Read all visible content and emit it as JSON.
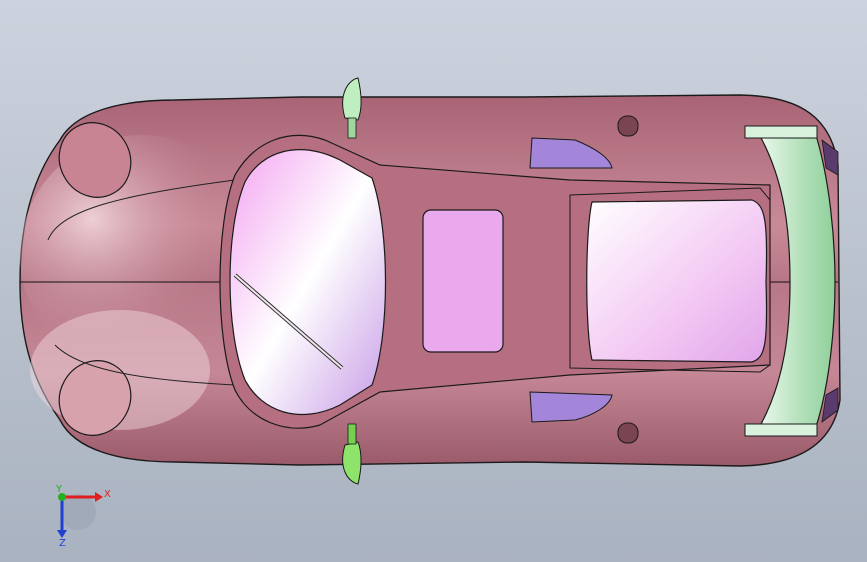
{
  "viewport": {
    "background_top": "#cdd3de",
    "background_bottom": "#a9b2c0",
    "model": "car-top-view"
  },
  "colors": {
    "body_pink": "#b87786",
    "body_light": "#e9c6cc",
    "glass": "#f0b8f0",
    "green": "#9fe79a",
    "bright_green": "#66dd33",
    "wing": "#c9e8cf",
    "purple": "#9b80d6"
  },
  "triad": {
    "x_label": "X",
    "y_label": "Y",
    "z_label": "Z",
    "x_color": "#e02020",
    "y_color": "#20b020",
    "z_color": "#2040d0"
  }
}
